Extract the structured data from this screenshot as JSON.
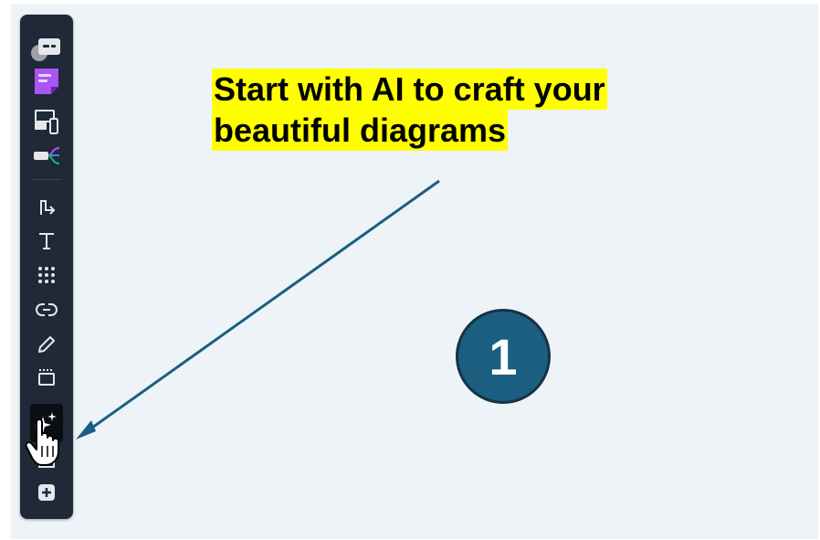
{
  "callout": {
    "line1": "Start with AI to craft your",
    "line2": "beautiful diagrams"
  },
  "step_badge": {
    "number": "1"
  },
  "toolbar": {
    "items": [
      {
        "name": "comment-tool",
        "icon": "comment-bubble-icon"
      },
      {
        "name": "sticky-note-tool",
        "icon": "sticky-note-icon"
      },
      {
        "name": "wireframe-tool",
        "icon": "wireframe-devices-icon"
      },
      {
        "name": "mind-map-tool",
        "icon": "mind-map-icon"
      },
      {
        "name": "connector-tool",
        "icon": "connector-arrow-icon"
      },
      {
        "name": "text-tool",
        "icon": "text-t-icon"
      },
      {
        "name": "templates-tool",
        "icon": "dot-grid-icon"
      },
      {
        "name": "link-tool",
        "icon": "link-icon"
      },
      {
        "name": "pen-tool",
        "icon": "pencil-icon"
      },
      {
        "name": "frame-tool",
        "icon": "frame-icon"
      },
      {
        "name": "ai-tool",
        "icon": "sparkles-icon",
        "active": true
      },
      {
        "name": "more-tools",
        "icon": "plus-square-icon"
      }
    ]
  },
  "colors": {
    "highlight": "#ffff00",
    "badge_fill": "#1b5e80",
    "arrow": "#1b5e80",
    "toolbar_bg": "#1f2937",
    "canvas_bg": "#eef3f7"
  }
}
